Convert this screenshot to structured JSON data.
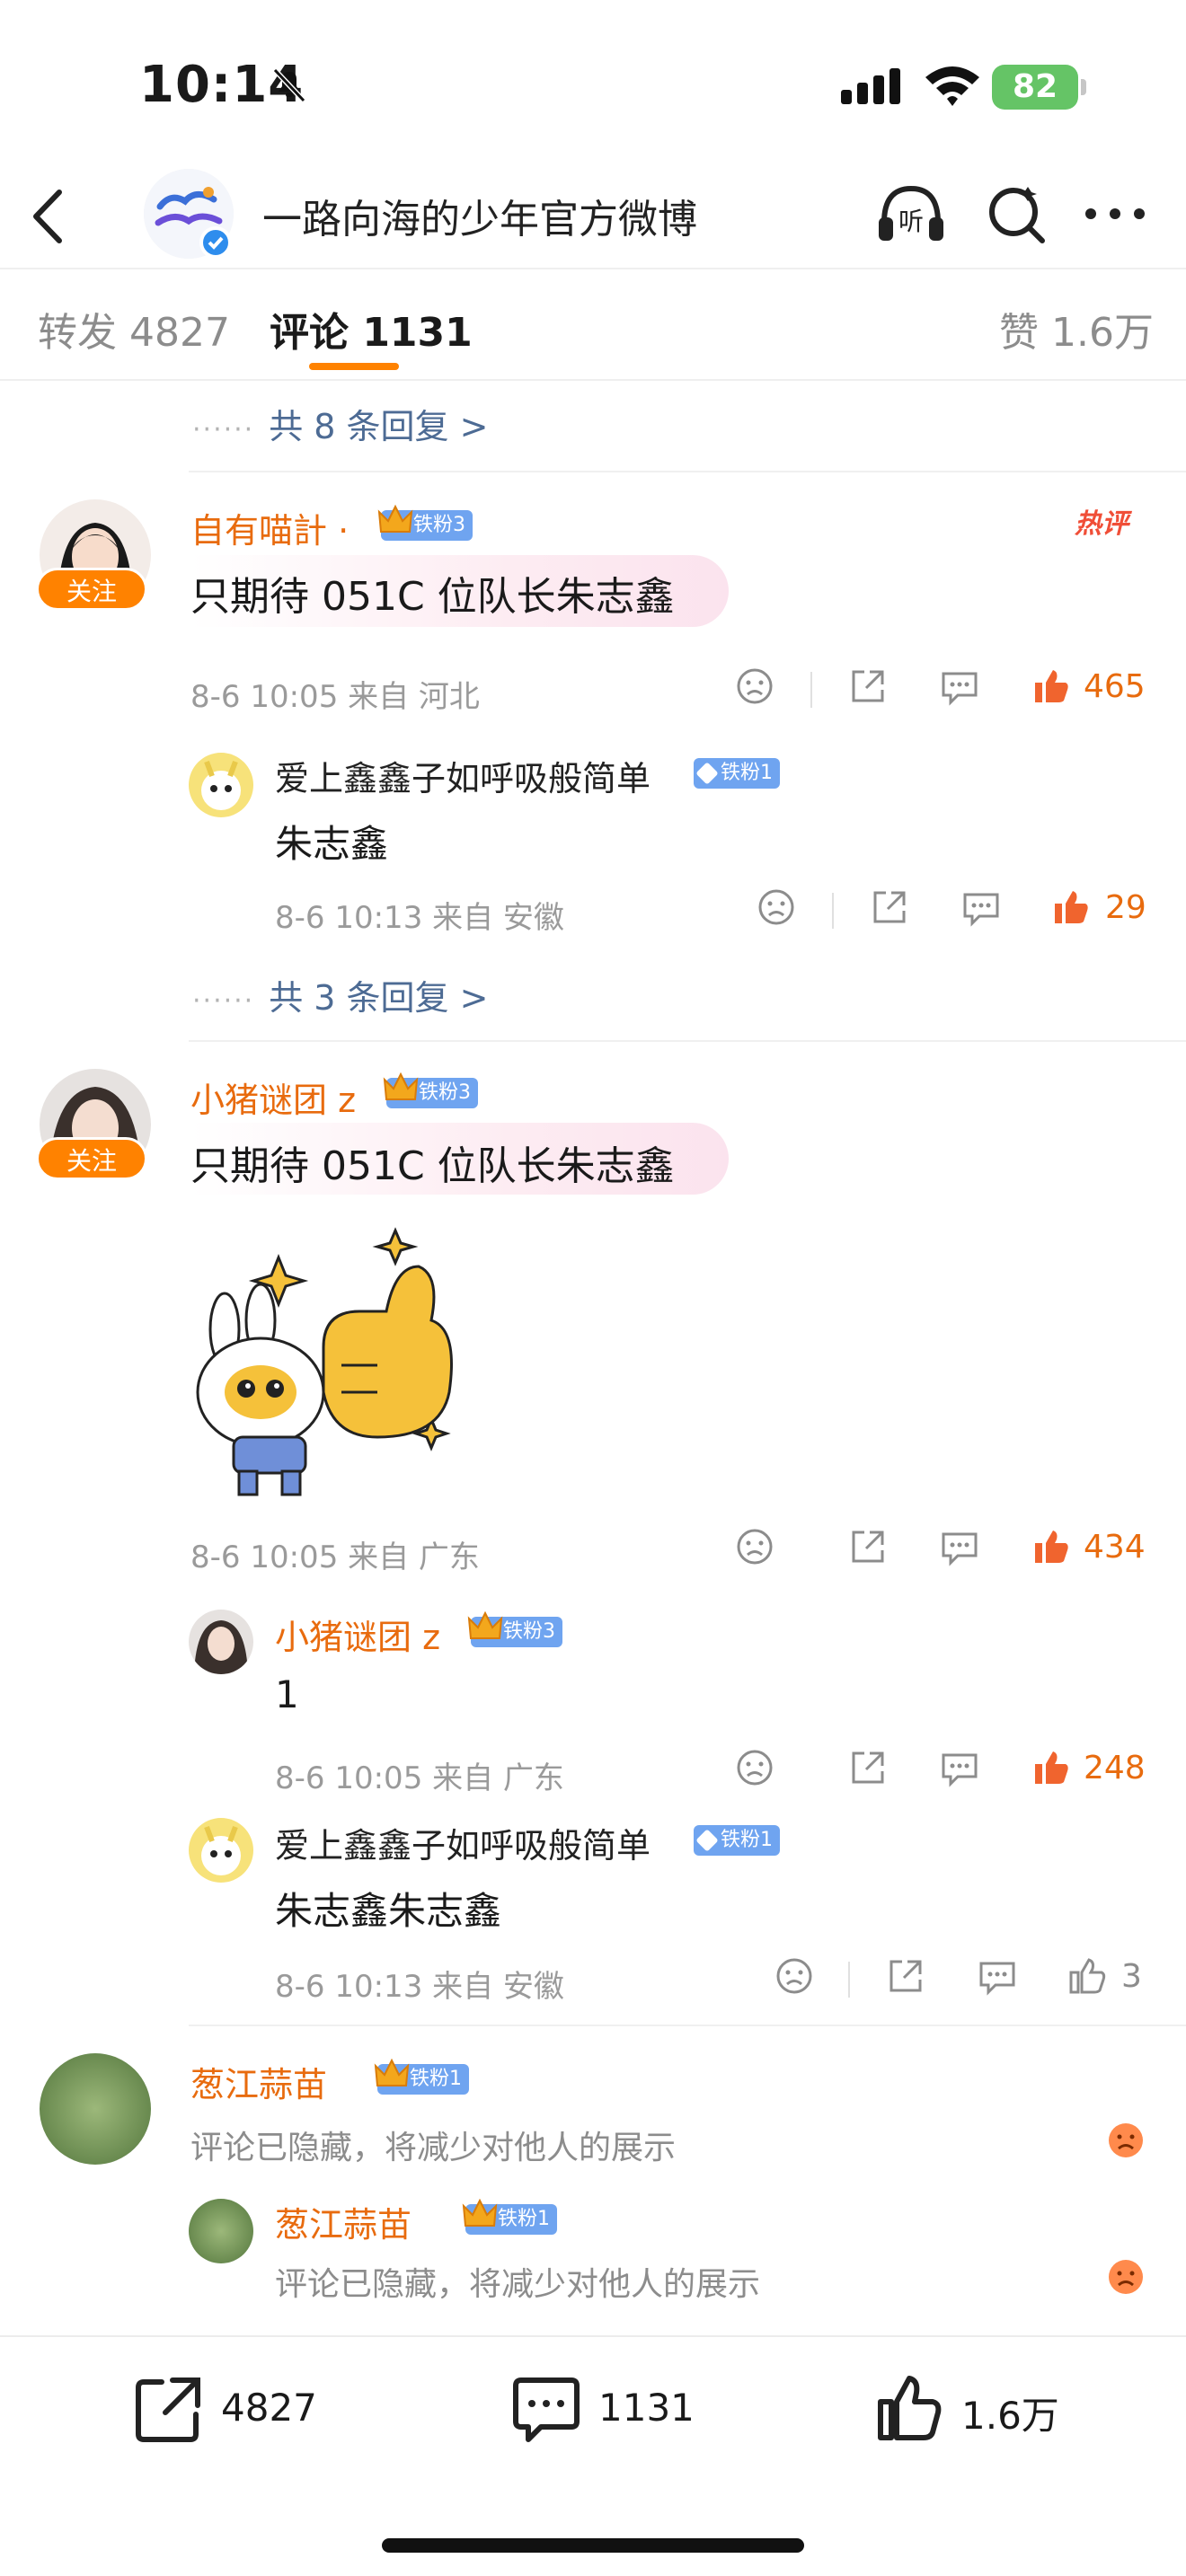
{
  "status_bar": {
    "time": "10:14",
    "battery": "82"
  },
  "nav": {
    "title": "一路向海的少年官方微博"
  },
  "tabs": [
    {
      "label": "转发 4827"
    },
    {
      "label": "评论 1131"
    },
    {
      "label": "赞 1.6万"
    }
  ],
  "thread_top": {
    "more_replies": "共 8 条回复 >"
  },
  "comments": [
    {
      "user": "自有喵計",
      "user_suffix": "·",
      "fan_badge": "铁粉3",
      "follow_label": "关注",
      "hot_label": "热评",
      "text": "只期待 051C 位队长朱志鑫",
      "meta": "8-6 10:05  来自 河北",
      "likes": "465",
      "replies": [
        {
          "user": "爱上鑫鑫子如呼吸般简单",
          "fan_badge": "铁粉1",
          "text": "朱志鑫",
          "meta": "8-6 10:13  来自 安徽",
          "likes": "29"
        }
      ],
      "more_replies": "共 3 条回复 >"
    },
    {
      "user": "小猪谜团 z",
      "fan_badge": "铁粉3",
      "follow_label": "关注",
      "text": "只期待 051C 位队长朱志鑫",
      "meta": "8-6 10:05  来自 广东",
      "likes": "434",
      "replies": [
        {
          "user": "小猪谜团 z",
          "fan_badge": "铁粉3",
          "text": "1",
          "meta": "8-6 10:05  来自 广东",
          "likes": "248"
        },
        {
          "user": "爱上鑫鑫子如呼吸般简单",
          "fan_badge": "铁粉1",
          "text": "朱志鑫朱志鑫",
          "meta": "8-6 10:13  来自 安徽",
          "likes": "3"
        }
      ]
    },
    {
      "user": "葱江蒜苗",
      "fan_badge": "铁粉1",
      "text": "评论已隐藏，将减少对他人的展示",
      "replies": [
        {
          "user": "葱江蒜苗",
          "fan_badge": "铁粉1",
          "text": "评论已隐藏，将减少对他人的展示"
        }
      ]
    }
  ],
  "bottom_bar": {
    "repost": "4827",
    "comment": "1131",
    "like": "1.6万"
  },
  "colors": {
    "accent": "#ff8200",
    "username": "#e86b0e",
    "link": "#4d6b94",
    "badge": "#6fa4f0"
  }
}
